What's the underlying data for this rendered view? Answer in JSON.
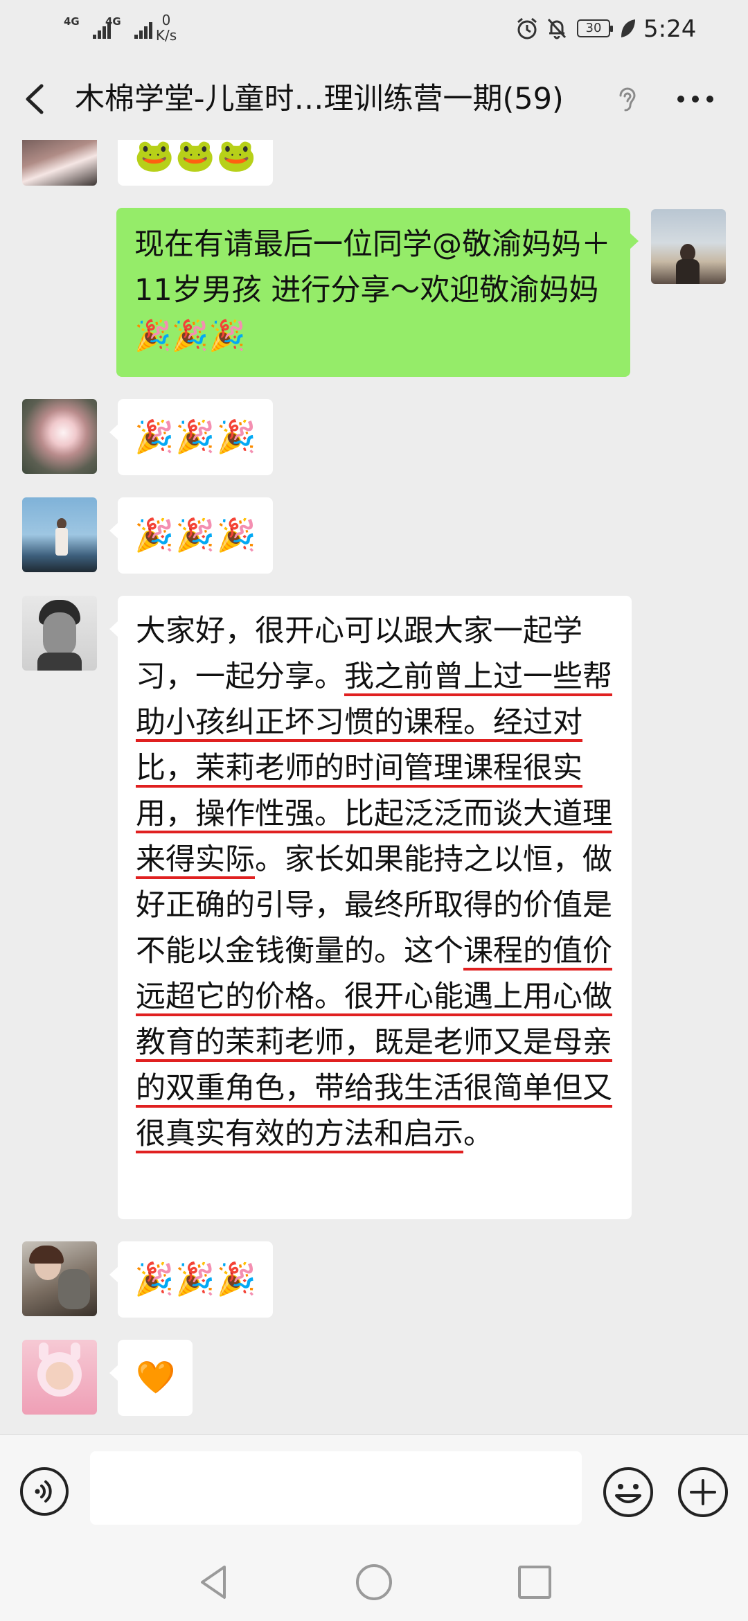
{
  "status_bar": {
    "network_1": "4G",
    "network_2": "4G",
    "speed_value": "0",
    "speed_unit": "K/s",
    "battery": "30",
    "time": "5:24"
  },
  "header": {
    "title": "木棉学堂-儿童时…理训练营一期(59)"
  },
  "messages": [
    {
      "type": "emoji",
      "side": "left",
      "content": "🐸🐸🐸"
    },
    {
      "type": "text",
      "side": "right",
      "content": "现在有请最后一位同学@敬渝妈妈＋11岁男孩 进行分享～欢迎敬渝妈妈🎉🎉🎉"
    },
    {
      "type": "emoji",
      "side": "left",
      "content": "🎉🎉🎉"
    },
    {
      "type": "emoji",
      "side": "left",
      "content": "🎉🎉🎉"
    },
    {
      "type": "text",
      "side": "left",
      "part1": "大家好，很开心可以跟大家一起学习，一起分享。",
      "part2": "我之前曾上过一些帮助小孩纠正坏习惯的课程。经过对比，茉莉老师的时间管理课程很实用，操作性强。比起泛泛而谈大道理来得实际",
      "part3": "。家长如果能持之以恒，做好正确的引导，最终所取得的价值是不能以金钱衡量的。这个",
      "part4": "课程的值价远超它的价格。很开心能遇上用心做教育的茉莉老师，既是老师又是母亲的双重角色，带给我生活很简单但又很真实有效的方法和启示",
      "part5": "。"
    },
    {
      "type": "emoji",
      "side": "left",
      "content": "🎉🎉🎉"
    },
    {
      "type": "emoji",
      "side": "left",
      "content": "🧡"
    }
  ],
  "input_bar": {
    "placeholder": ""
  },
  "icons": {
    "back": "chevron-left-icon",
    "ear": "ear-icon",
    "more": "more-dots-icon",
    "voice": "voice-icon",
    "emoji": "smiley-icon",
    "plus": "plus-circle-icon"
  },
  "colors": {
    "background": "#ededed",
    "own_bubble": "#95ec69",
    "other_bubble": "#ffffff",
    "underline": "#e02020"
  }
}
